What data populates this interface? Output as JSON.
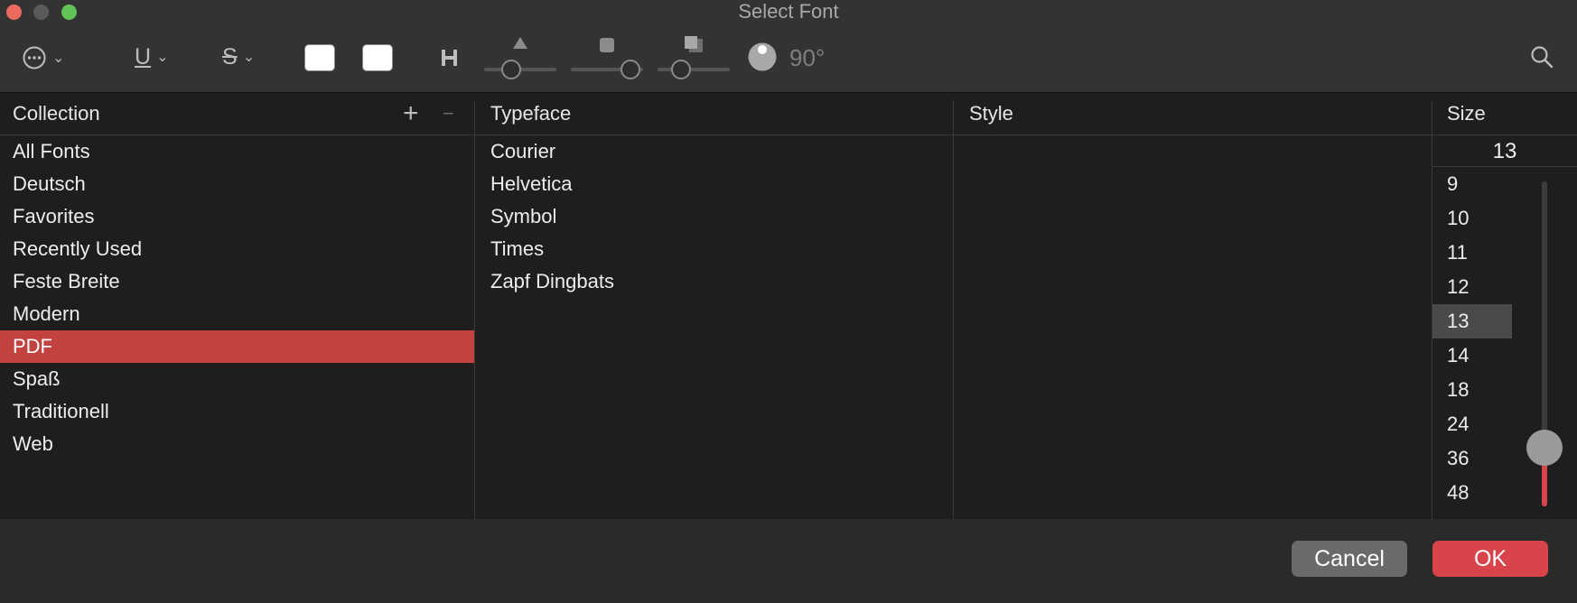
{
  "window": {
    "title": "Select Font"
  },
  "toolbar": {
    "rotation_label": "90°",
    "icons": [
      "more-options-icon",
      "underline-icon",
      "strikethrough-icon",
      "text-color-swatch",
      "document-color-swatch",
      "text-spacing-icon",
      "shadow-opacity-icon",
      "shadow-blur-icon",
      "shadow-offset-icon",
      "rotation-dial-icon",
      "search-icon"
    ]
  },
  "columns": {
    "collection": "Collection",
    "typeface": "Typeface",
    "style": "Style",
    "size": "Size"
  },
  "collection_actions": {
    "add": "+",
    "remove": "−"
  },
  "collections": {
    "items": [
      "All Fonts",
      "Deutsch",
      "Favorites",
      "Recently Used",
      "Feste Breite",
      "Modern",
      "PDF",
      "Spaß",
      "Traditionell",
      "Web"
    ],
    "selected": "PDF"
  },
  "typefaces": [
    "Courier",
    "Helvetica",
    "Symbol",
    "Times",
    "Zapf Dingbats"
  ],
  "size": {
    "current": "13",
    "options": [
      "9",
      "10",
      "11",
      "12",
      "13",
      "14",
      "18",
      "24",
      "36",
      "48"
    ],
    "selected": "13"
  },
  "buttons": {
    "cancel": "Cancel",
    "ok": "OK"
  },
  "colors": {
    "accent": "#d9434a",
    "selection": "#c24240"
  }
}
